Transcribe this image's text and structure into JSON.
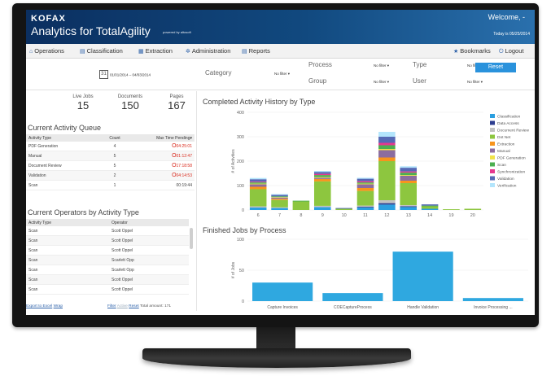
{
  "header": {
    "logo": "KOFAX",
    "app_title": "Analytics for TotalAgility",
    "powered_by": "powered by altosoft",
    "welcome": "Welcome, -",
    "datetime": "Today is 05/25/2014"
  },
  "nav": {
    "left": [
      "Operations",
      "Classification",
      "Extraction",
      "Administration",
      "Reports"
    ],
    "right": [
      "Bookmarks",
      "Logout"
    ]
  },
  "filters": {
    "date_range": "01/01/2014 – 04/03/2014",
    "category_label": "Category",
    "category_value": "No filter ▾",
    "process_label": "Process",
    "process_value": "No filter ▾",
    "group_label": "Group",
    "group_value": "No filter ▾",
    "type_label": "Type",
    "type_value": "No filter ▾",
    "user_label": "User",
    "user_value": "No filter ▾",
    "reset_label": "Reset"
  },
  "stats": [
    {
      "label": "Live Jobs",
      "value": "15"
    },
    {
      "label": "Documents",
      "value": "150"
    },
    {
      "label": "Pages",
      "value": "167"
    }
  ],
  "activity_queue": {
    "title": "Current Activity Queue",
    "columns": [
      "Activity Type",
      "Count",
      "Max Time Pending▾"
    ],
    "rows": [
      {
        "type": "PDF Generation",
        "count": "4",
        "time": "04:25:01",
        "alert": true
      },
      {
        "type": "Manual",
        "count": "5",
        "time": "01:12:47",
        "alert": true
      },
      {
        "type": "Document Review",
        "count": "5",
        "time": "17:18:58",
        "alert": true
      },
      {
        "type": "Validation",
        "count": "2",
        "time": "04:14:53",
        "alert": true
      },
      {
        "type": "Scan",
        "count": "1",
        "time": "00:19:44",
        "alert": false
      }
    ]
  },
  "operators": {
    "title": "Current Operators by Activity Type",
    "columns": [
      "Activity Type",
      "Operator"
    ],
    "rows": [
      {
        "type": "Scan",
        "operator": "Scott Oppel"
      },
      {
        "type": "Scan",
        "operator": "Scott Oppel"
      },
      {
        "type": "Scan",
        "operator": "Scott Oppel"
      },
      {
        "type": "Scan",
        "operator": "Scarlett Opp"
      },
      {
        "type": "Scan",
        "operator": "Scarlett Opp"
      },
      {
        "type": "Scan",
        "operator": "Scott Oppel"
      },
      {
        "type": "Scan",
        "operator": "Scott Oppel"
      }
    ]
  },
  "footer": {
    "export_label": "Export to Excel",
    "wrap_label": "Wrap",
    "filter_label": "Filter",
    "active_label": "Active",
    "reset_label": "Reset",
    "total_label": "Total amount: 171"
  },
  "colors": {
    "header_start": "#0b2f60",
    "header_end": "#2a70ad",
    "accent": "#2a92dc",
    "alert": "#d9291c",
    "chart_bar": "#2fa8e0"
  },
  "chart_data": [
    {
      "type": "bar",
      "stacked": true,
      "title": "Completed Activity History by Type",
      "xlabel": "",
      "ylabel": "# of Activities",
      "ylim": [
        0,
        400
      ],
      "yticks": [
        0,
        100,
        200,
        300,
        400
      ],
      "categories": [
        "6",
        "7",
        "8",
        "9",
        "10",
        "11",
        "12",
        "13",
        "14",
        "19",
        "20"
      ],
      "legend_position": "right",
      "series": [
        {
          "name": "Classification",
          "color": "#2b9fe0",
          "values": [
            10,
            8,
            0,
            12,
            0,
            10,
            22,
            12,
            5,
            0,
            0
          ]
        },
        {
          "name": "Data Access",
          "color": "#2d3d8f",
          "values": [
            0,
            0,
            0,
            0,
            0,
            3,
            6,
            3,
            0,
            0,
            0
          ]
        },
        {
          "name": "Document Review",
          "color": "#c2c2c2",
          "values": [
            5,
            3,
            0,
            5,
            0,
            5,
            12,
            5,
            0,
            0,
            0
          ]
        },
        {
          "name": "Dot Net",
          "color": "#8dc63f",
          "values": [
            70,
            30,
            35,
            100,
            5,
            60,
            160,
            90,
            10,
            3,
            5
          ]
        },
        {
          "name": "Extraction",
          "color": "#f7941d",
          "values": [
            10,
            5,
            0,
            10,
            0,
            12,
            15,
            10,
            0,
            0,
            0
          ]
        },
        {
          "name": "Manual",
          "color": "#8c6d9f",
          "values": [
            10,
            5,
            0,
            5,
            0,
            15,
            30,
            20,
            0,
            0,
            0
          ]
        },
        {
          "name": "PDF Generation",
          "color": "#f1e34a",
          "values": [
            3,
            2,
            0,
            3,
            0,
            3,
            5,
            3,
            0,
            0,
            0
          ]
        },
        {
          "name": "Scan",
          "color": "#4caf50",
          "values": [
            5,
            3,
            3,
            8,
            0,
            5,
            15,
            10,
            3,
            0,
            0
          ]
        },
        {
          "name": "Synchronization",
          "color": "#e6388f",
          "values": [
            3,
            0,
            0,
            5,
            0,
            5,
            10,
            5,
            0,
            0,
            0
          ]
        },
        {
          "name": "Validation",
          "color": "#5569b5",
          "values": [
            10,
            6,
            0,
            8,
            3,
            10,
            25,
            15,
            5,
            0,
            0
          ]
        },
        {
          "name": "Verification",
          "color": "#b3e5fc",
          "values": [
            5,
            3,
            0,
            4,
            0,
            4,
            20,
            6,
            0,
            0,
            0
          ]
        }
      ]
    },
    {
      "type": "bar",
      "title": "Finished Jobs by Process",
      "xlabel": "",
      "ylabel": "# of Jobs",
      "ylim": [
        0,
        100
      ],
      "yticks": [
        0,
        50,
        100
      ],
      "categories": [
        "Capture Invoices",
        "COECaptureProcess",
        "Handle Validation",
        "Invoice Processing ..."
      ],
      "values": [
        30,
        13,
        80,
        5
      ],
      "color": "#2fa8e0"
    }
  ]
}
